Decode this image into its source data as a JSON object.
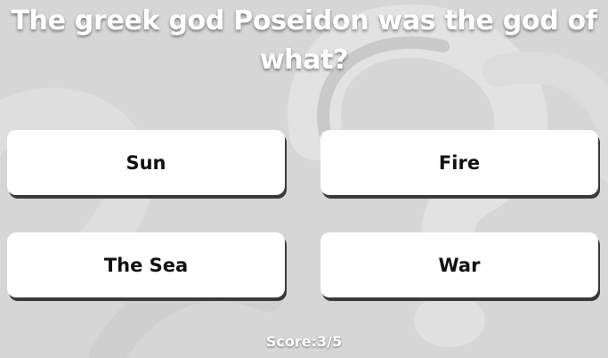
{
  "quiz": {
    "question": "The greek god Poseidon was the god of what?",
    "answers": [
      {
        "label": "Sun"
      },
      {
        "label": "Fire"
      },
      {
        "label": "The Sea"
      },
      {
        "label": "War"
      }
    ],
    "score": "Score:3/5"
  },
  "colors": {
    "background": "#d6d6d6",
    "button": "#ffffff",
    "button_shadow": "#3a3a3a",
    "text_light": "#ffffff"
  }
}
